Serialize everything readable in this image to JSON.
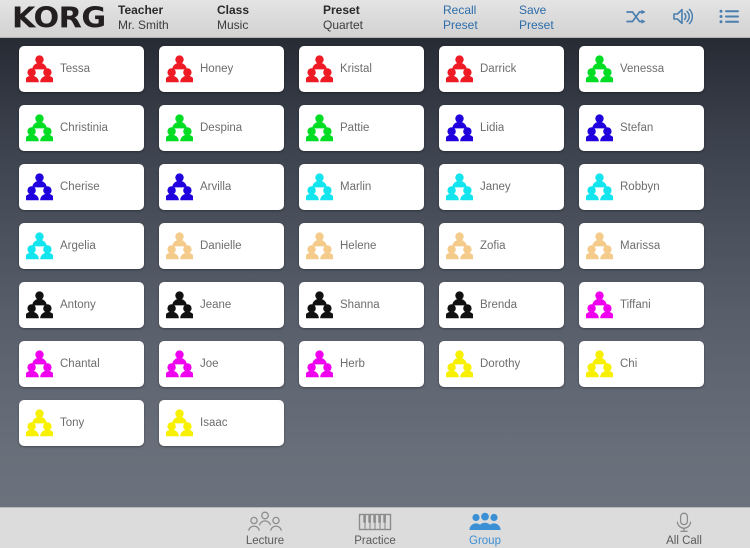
{
  "header": {
    "logo": "KORG",
    "fields": [
      {
        "label": "Teacher",
        "value": "Mr. Smith"
      },
      {
        "label": "Class",
        "value": "Music"
      },
      {
        "label": "Preset",
        "value": "Quartet"
      }
    ],
    "links": [
      {
        "label": "Recall Preset",
        "line1": "Recall",
        "line2": "Preset"
      },
      {
        "label": "Save Preset",
        "line1": "Save",
        "line2": "Preset"
      }
    ],
    "icons": [
      {
        "name": "shuffle-icon",
        "label": "Shuffle"
      },
      {
        "name": "speaker-icon",
        "label": "Speaker"
      },
      {
        "name": "list-icon",
        "label": "List"
      }
    ],
    "icon_color": "#4a7fae"
  },
  "colors": {
    "group_red": "#ee1b24",
    "group_green": "#00dd22",
    "group_blue": "#2000dd",
    "group_cyan": "#12e5ee",
    "group_tan": "#f5cb8b",
    "group_black": "#111111",
    "group_magenta": "#ef00ee",
    "group_yellow": "#f7f000",
    "accent": "#3b8fd4",
    "stage_top": "#262b34",
    "stage_bottom": "#6c727d",
    "card_bg": "#ffffff",
    "name_text": "#6d6d6d"
  },
  "students": [
    {
      "name": "Tessa",
      "group": "red",
      "color": "#ee1b24"
    },
    {
      "name": "Honey",
      "group": "red",
      "color": "#ee1b24"
    },
    {
      "name": "Kristal",
      "group": "red",
      "color": "#ee1b24"
    },
    {
      "name": "Darrick",
      "group": "red",
      "color": "#ee1b24"
    },
    {
      "name": "Venessa",
      "group": "green",
      "color": "#00dd22"
    },
    {
      "name": "Christinia",
      "group": "green",
      "color": "#00dd22"
    },
    {
      "name": "Despina",
      "group": "green",
      "color": "#00dd22"
    },
    {
      "name": "Pattie",
      "group": "green",
      "color": "#00dd22"
    },
    {
      "name": "Lidia",
      "group": "blue",
      "color": "#2000dd"
    },
    {
      "name": "Stefan",
      "group": "blue",
      "color": "#2000dd"
    },
    {
      "name": "Cherise",
      "group": "blue",
      "color": "#2000dd"
    },
    {
      "name": "Arvilla",
      "group": "blue",
      "color": "#2000dd"
    },
    {
      "name": "Marlin",
      "group": "cyan",
      "color": "#12e5ee"
    },
    {
      "name": "Janey",
      "group": "cyan",
      "color": "#12e5ee"
    },
    {
      "name": "Robbyn",
      "group": "cyan",
      "color": "#12e5ee"
    },
    {
      "name": "Argelia",
      "group": "cyan",
      "color": "#12e5ee"
    },
    {
      "name": "Danielle",
      "group": "tan",
      "color": "#f5cb8b"
    },
    {
      "name": "Helene",
      "group": "tan",
      "color": "#f5cb8b"
    },
    {
      "name": "Zofia",
      "group": "tan",
      "color": "#f5cb8b"
    },
    {
      "name": "Marissa",
      "group": "tan",
      "color": "#f5cb8b"
    },
    {
      "name": "Antony",
      "group": "black",
      "color": "#111111"
    },
    {
      "name": "Jeane",
      "group": "black",
      "color": "#111111"
    },
    {
      "name": "Shanna",
      "group": "black",
      "color": "#111111"
    },
    {
      "name": "Brenda",
      "group": "black",
      "color": "#111111"
    },
    {
      "name": "Tiffani",
      "group": "magenta",
      "color": "#ef00ee"
    },
    {
      "name": "Chantal",
      "group": "magenta",
      "color": "#ef00ee"
    },
    {
      "name": "Joe",
      "group": "magenta",
      "color": "#ef00ee"
    },
    {
      "name": "Herb",
      "group": "magenta",
      "color": "#ef00ee"
    },
    {
      "name": "Dorothy",
      "group": "yellow",
      "color": "#f7f000"
    },
    {
      "name": "Chi",
      "group": "yellow",
      "color": "#f7f000"
    },
    {
      "name": "Tony",
      "group": "yellow",
      "color": "#f7f000"
    },
    {
      "name": "Isaac",
      "group": "yellow",
      "color": "#f7f000"
    }
  ],
  "tabbar": {
    "tabs": [
      {
        "label": "Lecture",
        "icon": "lecture-people-outline-icon",
        "active": false
      },
      {
        "label": "Practice",
        "icon": "piano-keys-icon",
        "active": false
      },
      {
        "label": "Group",
        "icon": "group-people-icon",
        "active": true
      },
      {
        "label": "All Call",
        "icon": "microphone-icon",
        "active": false
      }
    ]
  }
}
